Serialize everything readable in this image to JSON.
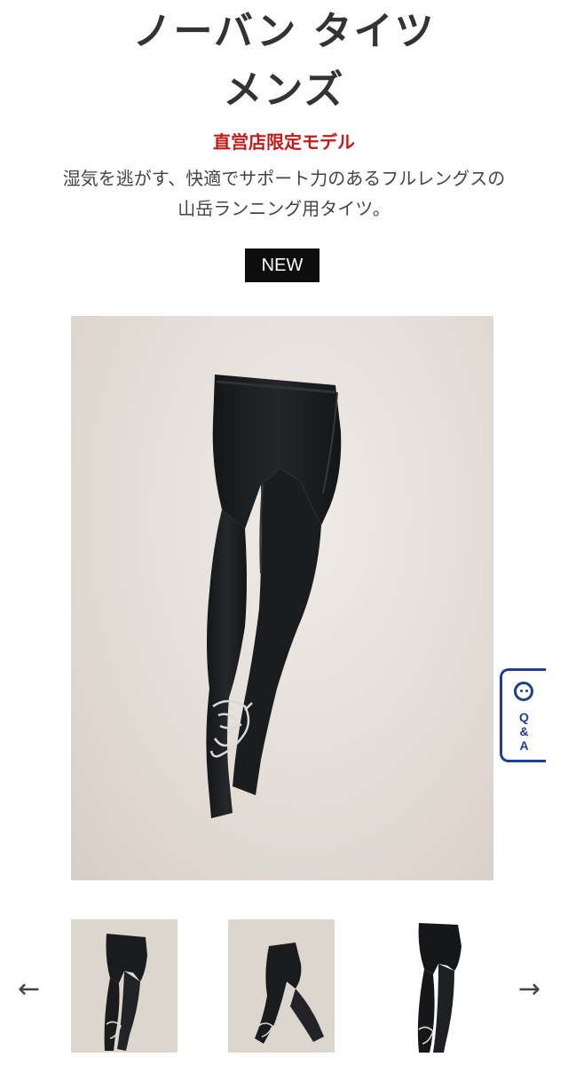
{
  "product": {
    "title_line1": "ノーバン タイツ",
    "title_line2": "メンズ",
    "limited_label": "直営店限定モデル",
    "description_line1": "湿気を逃がす、快適でサポート力のあるフルレングスの",
    "description_line2": "山岳ランニング用タイツ。",
    "badge": "NEW"
  },
  "qa_tab": {
    "label": "Q\n&\nA",
    "icon": "chat-bubble-icon"
  },
  "gallery": {
    "prev_arrow": "←",
    "next_arrow": "→",
    "thumbnails": [
      "thumbnail-front",
      "thumbnail-side",
      "thumbnail-white-bg"
    ]
  },
  "colors": {
    "accent_red": "#c21b17",
    "qa_blue": "#1f3f8f",
    "badge_bg": "#0d0d0d"
  }
}
